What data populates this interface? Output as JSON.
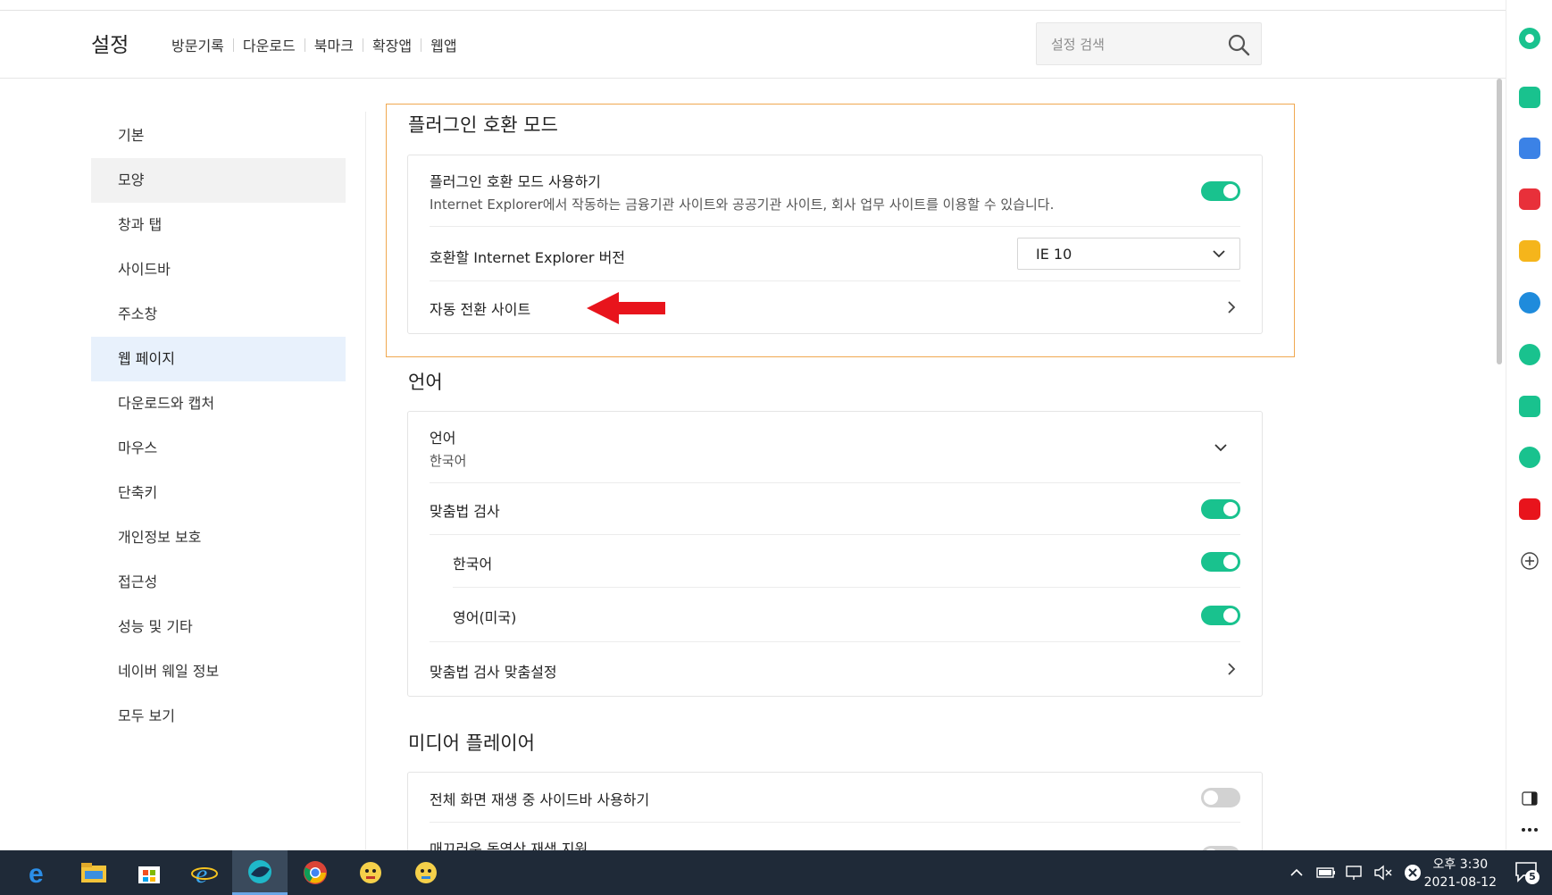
{
  "header": {
    "title": "설정",
    "nav": [
      "방문기록",
      "다운로드",
      "북마크",
      "확장앱",
      "웹앱"
    ],
    "search_placeholder": "설정 검색"
  },
  "leftnav": {
    "items": [
      {
        "label": "기본",
        "state": "normal"
      },
      {
        "label": "모양",
        "state": "hover"
      },
      {
        "label": "창과 탭",
        "state": "normal"
      },
      {
        "label": "사이드바",
        "state": "normal"
      },
      {
        "label": "주소창",
        "state": "normal"
      },
      {
        "label": "웹 페이지",
        "state": "active"
      },
      {
        "label": "다운로드와 캡처",
        "state": "normal"
      },
      {
        "label": "마우스",
        "state": "normal"
      },
      {
        "label": "단축키",
        "state": "normal"
      },
      {
        "label": "개인정보 보호",
        "state": "normal"
      },
      {
        "label": "접근성",
        "state": "normal"
      },
      {
        "label": "성능 및 기타",
        "state": "normal"
      },
      {
        "label": "네이버 웨일 정보",
        "state": "normal"
      },
      {
        "label": "모두 보기",
        "state": "normal"
      }
    ]
  },
  "plugin": {
    "title": "플러그인 호환 모드",
    "enable_label": "플러그인 호환 모드 사용하기",
    "enable_desc": "Internet Explorer에서 작동하는 금융기관 사이트와 공공기관 사이트, 회사 업무 사이트를 이용할 수 있습니다.",
    "enable_on": true,
    "version_label": "호환할 Internet Explorer 버전",
    "version_value": "IE 10",
    "auto_switch_label": "자동 전환 사이트"
  },
  "language": {
    "title": "언어",
    "lang_label": "언어",
    "lang_value": "한국어",
    "spell_label": "맞춤법 검사",
    "spell_korean": "한국어",
    "spell_english": "영어(미국)",
    "spell_custom": "맞춤법 검사 맞춤설정"
  },
  "media": {
    "title": "미디어 플레이어",
    "sidebar_label": "전체 화면 재생 중 사이드바 사용하기",
    "smooth_label": "매끄러운 동영상 재생 지원"
  },
  "taskbar": {
    "clock_time": "오후 3:30",
    "clock_date": "2021-08-12",
    "notif_count": "5"
  },
  "colors": {
    "accent_toggle": "#19c28e",
    "highlight_border": "#f0a850",
    "active_nav": "#e8f1fc",
    "arrow": "#e8141c"
  }
}
